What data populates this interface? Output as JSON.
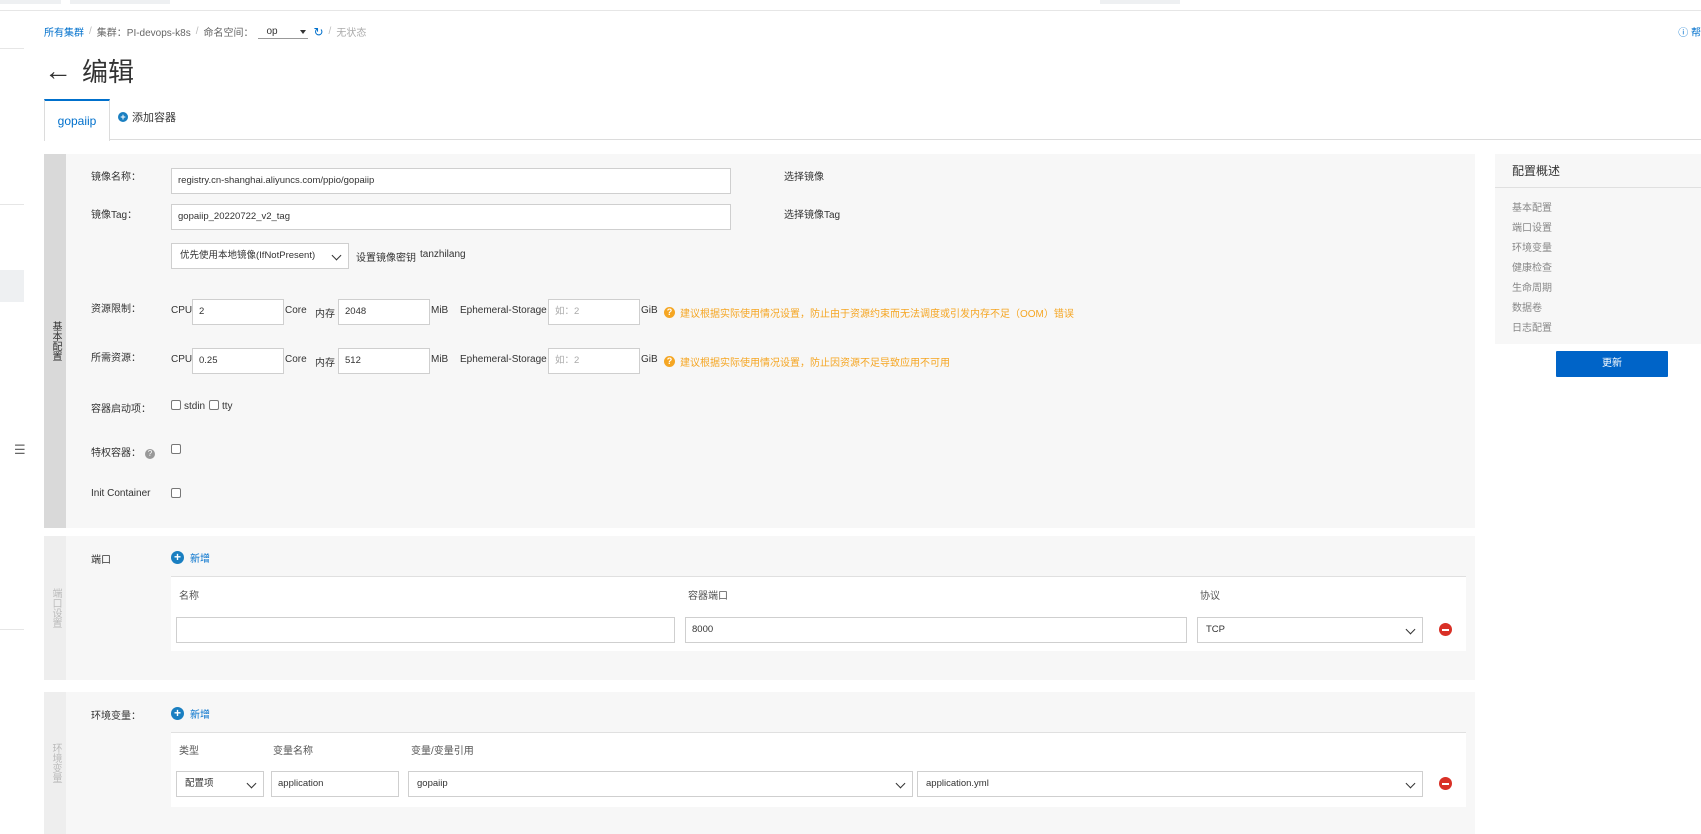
{
  "breadcrumb": {
    "all_clusters": "所有集群",
    "cluster": "集群：PI-devops-k8s",
    "namespace_label": "命名空间：",
    "namespace_value": "op",
    "status": "无状态"
  },
  "help_label": "帮",
  "page_title": "编辑",
  "tabs": {
    "active": "gopaiip",
    "add_container": "添加容器"
  },
  "basic": {
    "side_label": "基本配置",
    "image_name_label": "镜像名称：",
    "image_name_value": "registry.cn-shanghai.aliyuncs.com/ppio/gopaiip",
    "select_image": "选择镜像",
    "image_tag_label": "镜像Tag：",
    "image_tag_value": "gopaiip_20220722_v2_tag",
    "select_image_tag": "选择镜像Tag",
    "pull_policy": "优先使用本地镜像(IfNotPresent)",
    "set_secret": "设置镜像密钥",
    "secret_value": "tanzhilang",
    "limits_label": "资源限制：",
    "requests_label": "所需资源：",
    "cpu": "CPU",
    "core": "Core",
    "memory": "内存",
    "mib": "MiB",
    "ephemeral": "Ephemeral-Storage",
    "gib": "GiB",
    "limit_cpu": "2",
    "limit_mem": "2048",
    "limit_eph_placeholder": "如：2",
    "request_cpu": "0.25",
    "request_mem": "512",
    "request_eph_placeholder": "如：2",
    "limit_warning": "建议根据实际使用情况设置，防止由于资源约束而无法调度或引发内存不足（OOM）错误",
    "request_warning": "建议根据实际使用情况设置，防止因资源不足导致应用不可用",
    "startup_label": "容器启动项：",
    "stdin": "stdin",
    "tty": "tty",
    "privileged_label": "特权容器：",
    "init_label": "Init Container"
  },
  "ports": {
    "side_label": "端口设置",
    "label": "端口",
    "add": "新增",
    "col_name": "名称",
    "col_port": "容器端口",
    "col_protocol": "协议",
    "row_name": "",
    "row_port": "8000",
    "row_protocol": "TCP"
  },
  "env": {
    "side_label": "环境变量",
    "label": "环境变量：",
    "add": "新增",
    "col_type": "类型",
    "col_name": "变量名称",
    "col_ref": "变量/变量引用",
    "row_type": "配置项",
    "row_name": "application",
    "row_ref": "gopaiip",
    "row_key": "application.yml"
  },
  "overview": {
    "title": "配置概述",
    "items": [
      "基本配置",
      "端口设置",
      "环境变量",
      "健康检查",
      "生命周期",
      "数据卷",
      "日志配置"
    ],
    "update": "更新"
  }
}
